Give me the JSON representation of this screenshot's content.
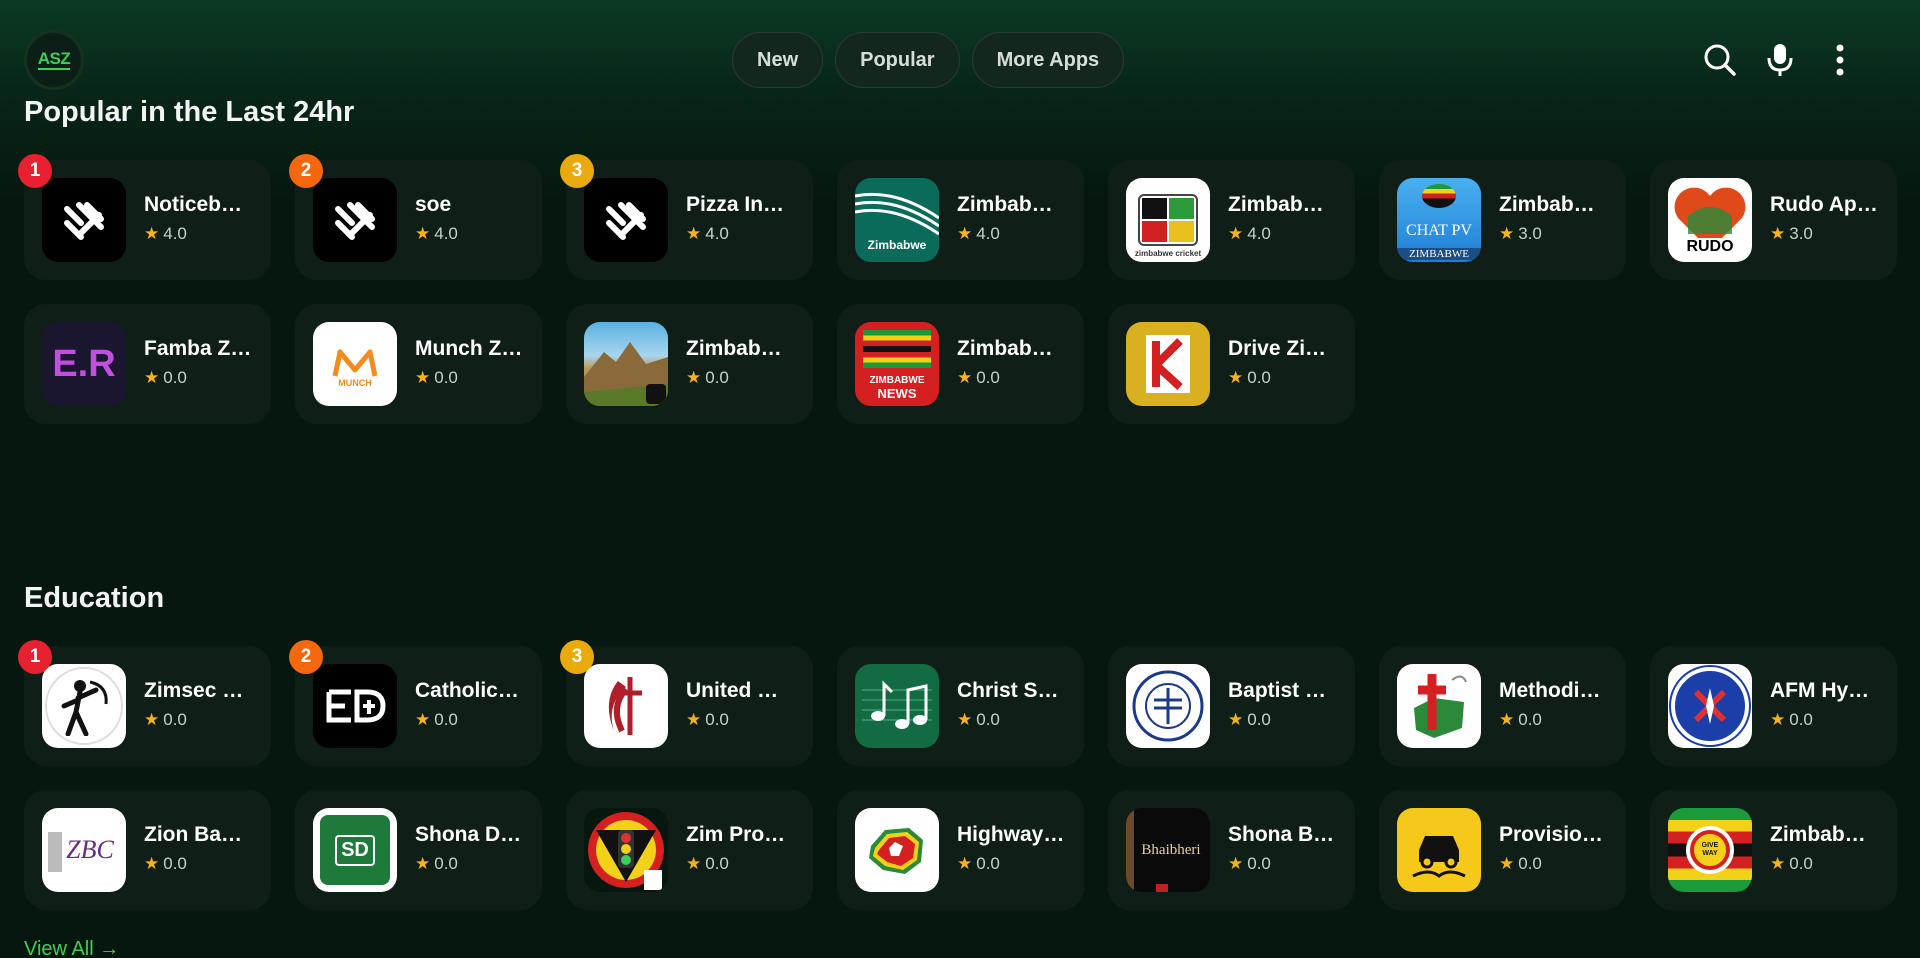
{
  "brand": {
    "logo_text": "ASZ",
    "accent": "#3fd14c"
  },
  "nav": {
    "items": [
      "New",
      "Popular",
      "More Apps"
    ]
  },
  "actions": {
    "icons": [
      "search-icon",
      "microphone-icon",
      "more-vertical-icon"
    ]
  },
  "badge_colors": [
    "#e8202f",
    "#f4670d",
    "#eaaa0b"
  ],
  "sections": [
    {
      "title": "Popular in the Last 24hr",
      "apps": [
        {
          "name": "Noticeb…",
          "rating": "4.0",
          "rank": "1",
          "icon": "slash-x-logo"
        },
        {
          "name": "soe",
          "rating": "4.0",
          "rank": "2",
          "icon": "slash-x-logo"
        },
        {
          "name": "Pizza In…",
          "rating": "4.0",
          "rank": "3",
          "icon": "slash-x-logo"
        },
        {
          "name": "Zimbab…",
          "rating": "4.0",
          "icon": "zimbabwe-wave-logo",
          "icon_text": "Zimbabwe"
        },
        {
          "name": "Zimbab…",
          "rating": "4.0",
          "icon": "zimbabwe-cricket-logo",
          "icon_text": "zimbabwe cricket"
        },
        {
          "name": "Zimbab…",
          "rating": "3.0",
          "icon": "chat-pv-zimbabwe-logo",
          "icon_text": "CHAT PV",
          "icon_text2": "ZIMBABWE"
        },
        {
          "name": "Rudo Ap…",
          "rating": "3.0",
          "icon": "rudo-heart-logo",
          "icon_text": "RUDO"
        },
        {
          "name": "Famba Z…",
          "rating": "0.0",
          "icon": "er-logo",
          "icon_text": "E.R"
        },
        {
          "name": "Munch Z…",
          "rating": "0.0",
          "icon": "munch-logo",
          "icon_text": "MUNCH"
        },
        {
          "name": "Zimbab…",
          "rating": "0.0",
          "icon": "landscape-photo"
        },
        {
          "name": "Zimbab…",
          "rating": "0.0",
          "icon": "zimbabwe-news-flag-logo",
          "icon_text": "ZIMBABWE",
          "icon_text2": "NEWS"
        },
        {
          "name": "Drive Zi…",
          "rating": "0.0",
          "icon": "drive-zimbabwe-logo"
        }
      ]
    },
    {
      "title": "Education",
      "apps": [
        {
          "name": "Zimsec …",
          "rating": "0.0",
          "rank": "1",
          "icon": "warrior-silhouette-logo"
        },
        {
          "name": "Catholic…",
          "rating": "0.0",
          "rank": "2",
          "icon": "catholic-logo"
        },
        {
          "name": "United …",
          "rating": "0.0",
          "rank": "3",
          "icon": "methodist-cross-flame-logo"
        },
        {
          "name": "Christ S…",
          "rating": "0.0",
          "icon": "music-notes-icon"
        },
        {
          "name": "Baptist …",
          "rating": "0.0",
          "icon": "baptist-seal-logo"
        },
        {
          "name": "Methodi…",
          "rating": "0.0",
          "icon": "red-cross-map-logo"
        },
        {
          "name": "AFM Hy…",
          "rating": "0.0",
          "icon": "afm-emblem-logo"
        },
        {
          "name": "Zion Ba…",
          "rating": "0.0",
          "icon": "zbc-logo",
          "icon_text": "ZBC"
        },
        {
          "name": "Shona D…",
          "rating": "0.0",
          "icon": "sd-book-logo",
          "icon_text": "SD"
        },
        {
          "name": "Zim Pro…",
          "rating": "0.0",
          "icon": "traffic-light-logo"
        },
        {
          "name": "Highway…",
          "rating": "0.0",
          "icon": "zimbabwe-map-logo"
        },
        {
          "name": "Shona B…",
          "rating": "0.0",
          "icon": "bible-book-logo",
          "icon_text": "Bhaibheri"
        },
        {
          "name": "Provisio…",
          "rating": "0.0",
          "icon": "car-road-icon"
        },
        {
          "name": "Zimbab…",
          "rating": "0.0",
          "icon": "give-way-flag-logo",
          "icon_text": "GIVE WAY"
        }
      ]
    }
  ],
  "view_all": "View All →"
}
